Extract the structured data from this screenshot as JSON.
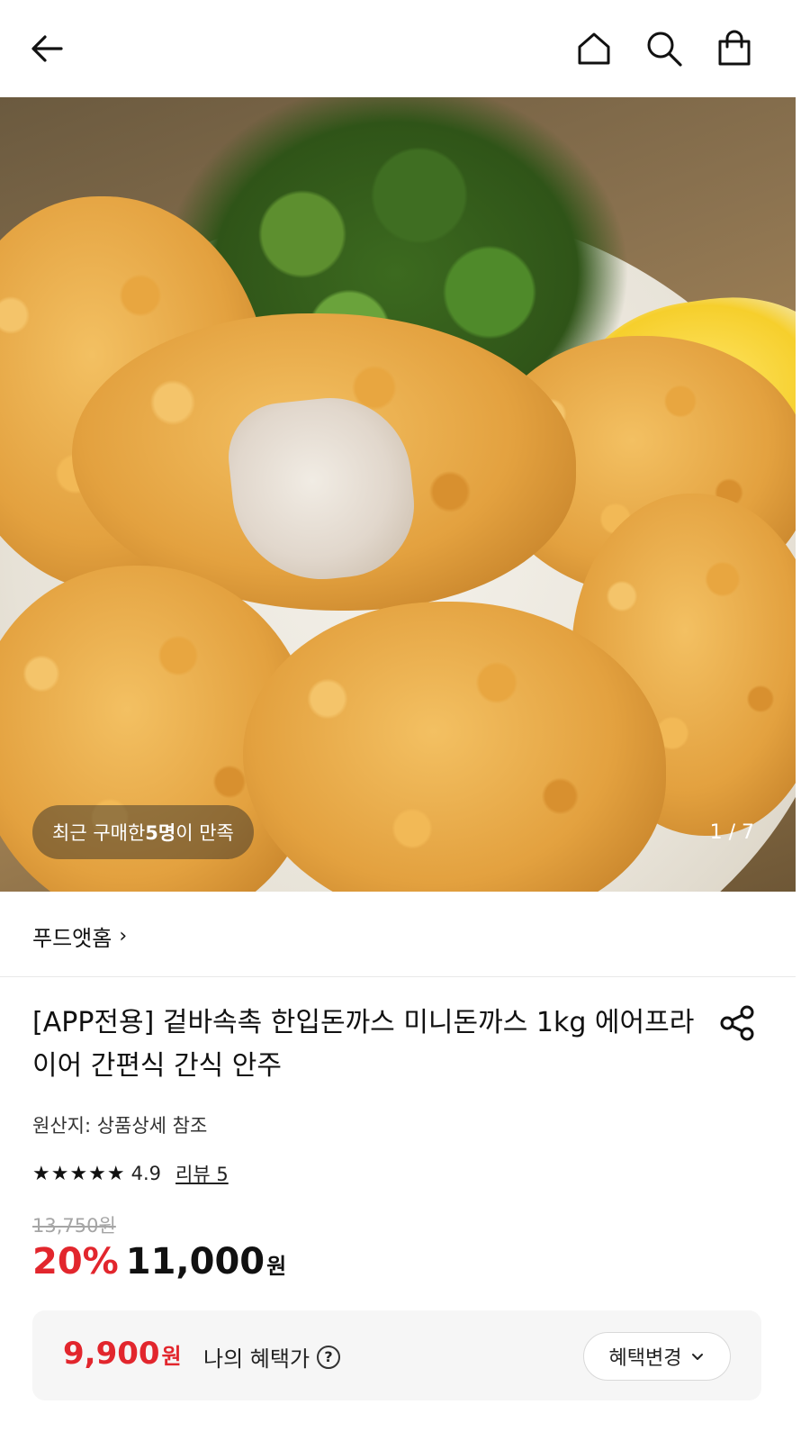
{
  "header": {
    "back_icon": "arrow-left-icon",
    "home_icon": "home-icon",
    "search_icon": "search-icon",
    "cart_icon": "shopping-bag-icon"
  },
  "hero": {
    "satisfaction_prefix": "최근 구매한 ",
    "satisfaction_count": "5명",
    "satisfaction_suffix": "이 만족",
    "image_counter": "1 / 7"
  },
  "seller": {
    "name": "푸드앳홈",
    "chevron": "›"
  },
  "product": {
    "title": "[APP전용] 겉바속촉 한입돈까스 미니돈까스 1kg 에어프라이어 간편식 간식 안주",
    "share_icon": "share-icon",
    "origin": "원산지: 상품상세 참조",
    "rating_stars": "★★★★★",
    "rating": "4.9",
    "review_link": "리뷰 5",
    "original_price": "13,750원",
    "discount_rate": "20%",
    "sale_price": "11,000",
    "sale_currency": "원"
  },
  "benefit": {
    "price": "9,900",
    "currency": "원",
    "label": "나의 혜택가",
    "help_icon": "?",
    "change_button": "혜택변경",
    "change_chevron": "⌄"
  },
  "colors": {
    "accent_red": "#e2262d",
    "text": "#111111",
    "muted": "#a5a5a5",
    "benefit_bg": "#f6f6f6"
  }
}
